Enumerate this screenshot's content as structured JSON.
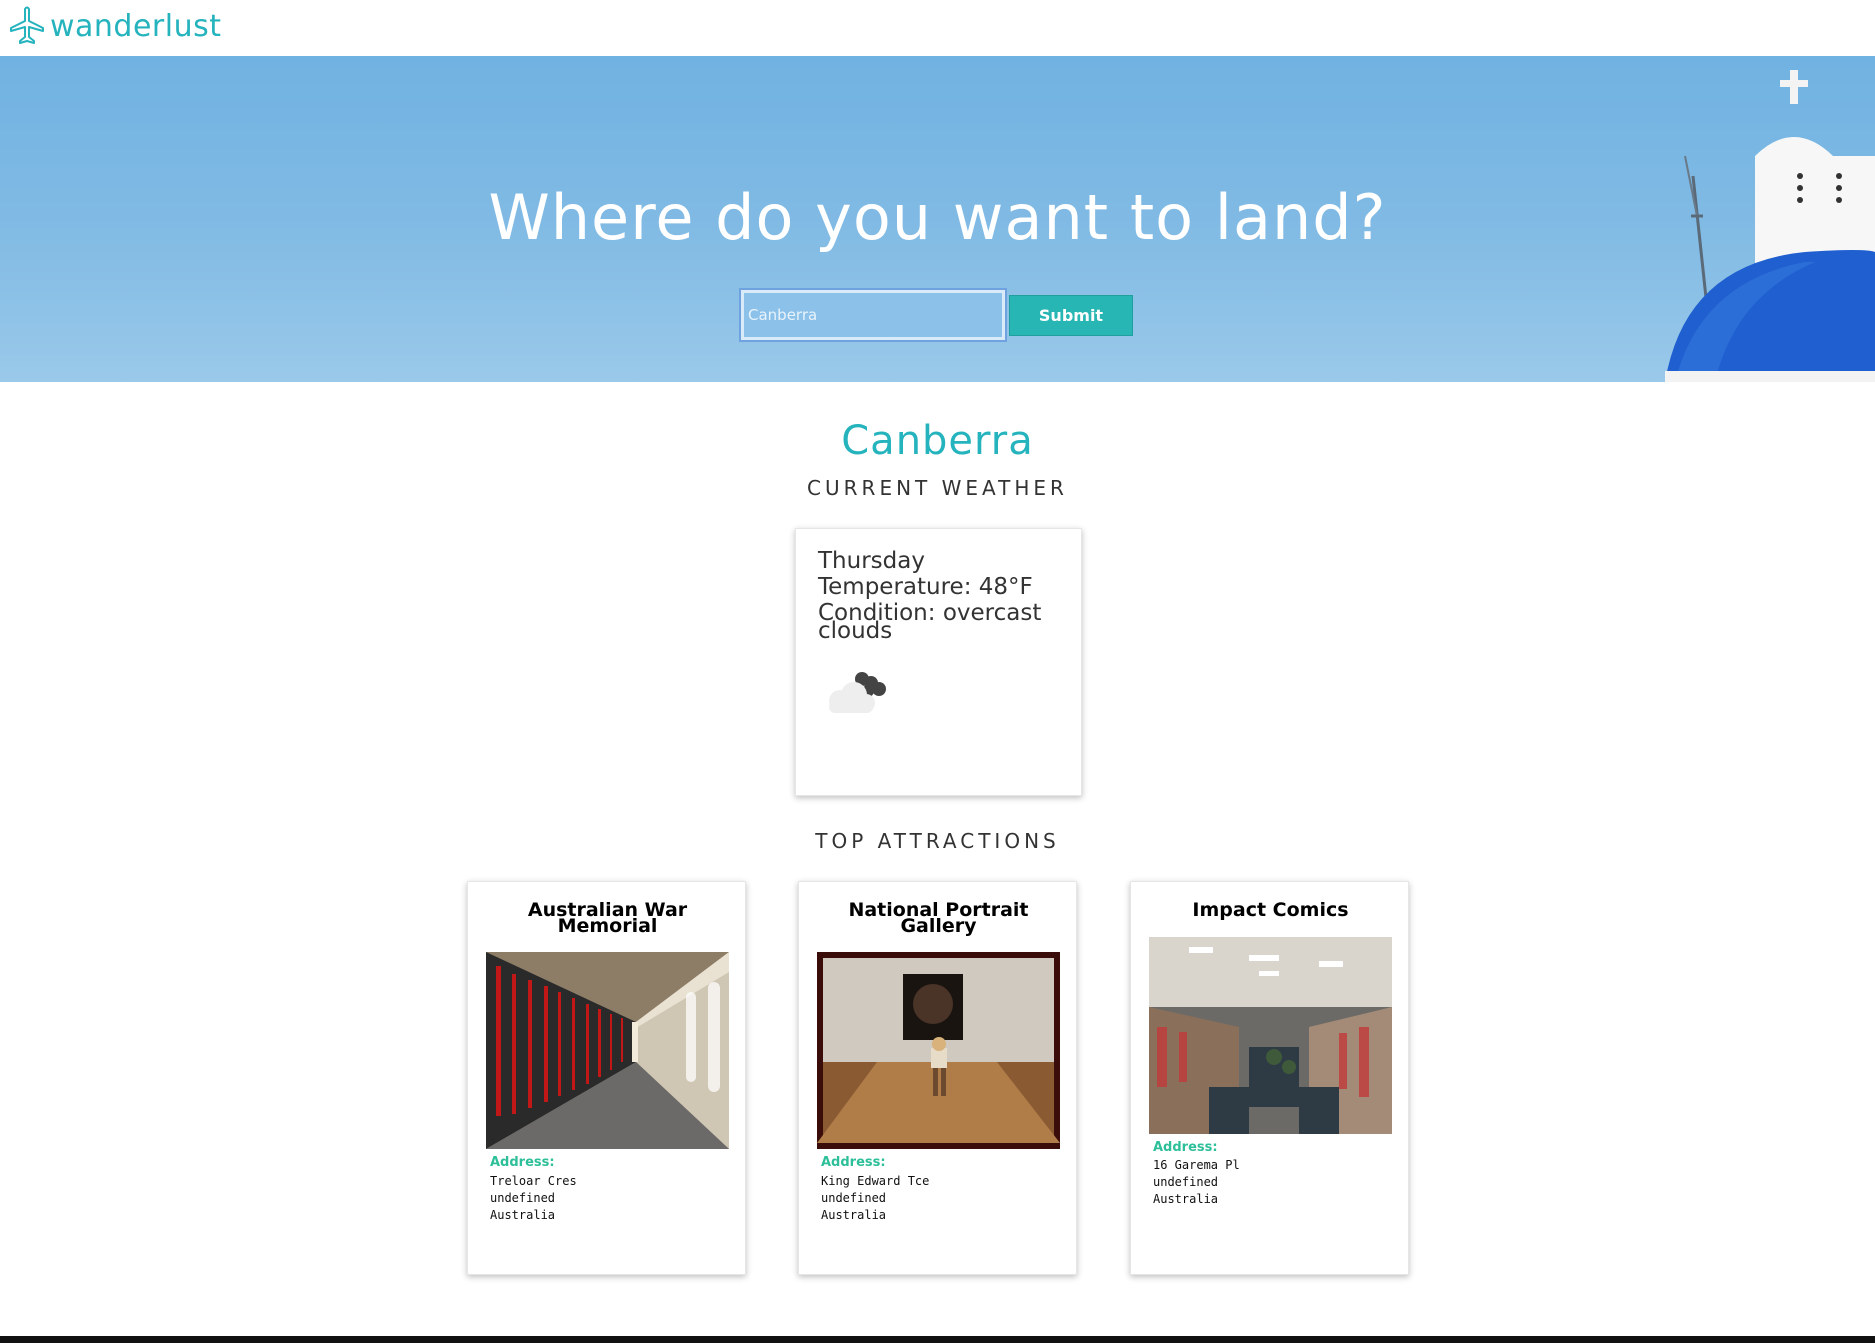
{
  "brand": {
    "name": "wanderlust",
    "icon": "airplane-icon",
    "color": "#25b3bd"
  },
  "hero": {
    "title": "Where do you want to land?",
    "search_value": "Canberra",
    "submit_label": "Submit"
  },
  "weather": {
    "city": "Canberra",
    "heading": "CURRENT WEATHER",
    "day": "Thursday",
    "temperature": "Temperature: 48°F",
    "condition_line1": "Condition: overcast",
    "condition_line2": "clouds",
    "icon": "overcast-clouds-icon"
  },
  "attractions": {
    "heading": "TOP ATTRACTIONS",
    "items": [
      {
        "name_line1": "Australian War",
        "name_line2": "Memorial",
        "address_label": "Address:",
        "address_line1": "Treloar Cres",
        "address_line2": "undefined",
        "address_line3": "Australia"
      },
      {
        "name_line1": "National Portrait",
        "name_line2": "Gallery",
        "address_label": "Address:",
        "address_line1": "King Edward Tce",
        "address_line2": "undefined",
        "address_line3": "Australia"
      },
      {
        "name_line1": "Impact Comics",
        "name_line2": "",
        "address_label": "Address:",
        "address_line1": "16 Garema Pl",
        "address_line2": "undefined",
        "address_line3": "Australia"
      }
    ]
  },
  "colors": {
    "accent": "#25b3bd",
    "submit": "#27b6b4",
    "address_label": "#2dbf99"
  }
}
